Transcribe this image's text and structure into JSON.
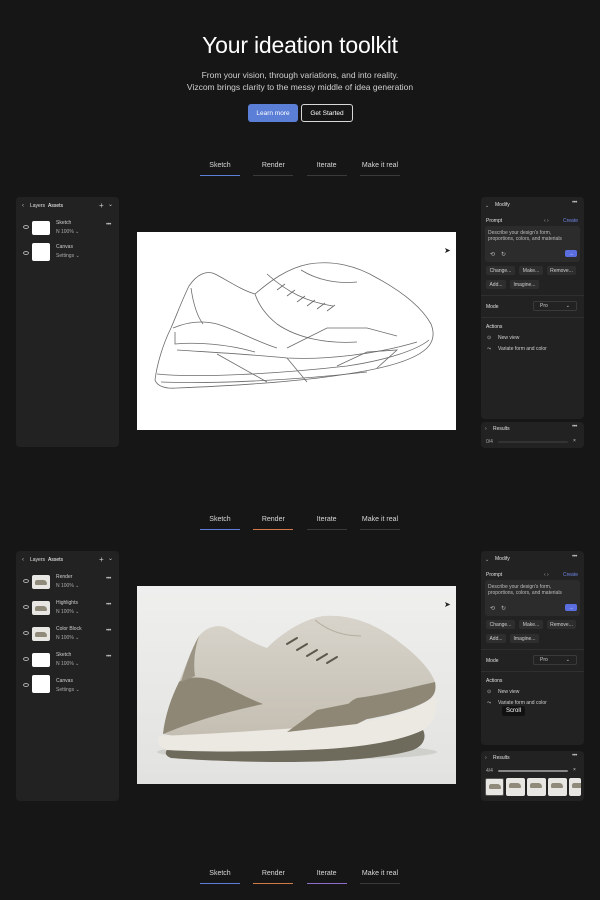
{
  "hero": {
    "title": "Your ideation toolkit",
    "subtitle_line1": "From your vision, through variations, and into reality.",
    "subtitle_line2": "Vizcom brings clarity to the messy middle of idea generation",
    "learn_more": "Learn more",
    "get_started": "Get Started"
  },
  "tabs": [
    "Sketch",
    "Render",
    "Iterate",
    "Make it real"
  ],
  "layers_panel": {
    "tab_layers": "Layers",
    "tab_assets": "Assets",
    "add": "+",
    "chevron": "⌄",
    "more": "•••"
  },
  "section1": {
    "layers": [
      {
        "name": "Sketch",
        "meta": "N 100%"
      },
      {
        "name": "Canvas",
        "meta": "Settings"
      }
    ],
    "results_count": "0/4"
  },
  "section2": {
    "layers": [
      {
        "name": "Render",
        "meta": "N 100%"
      },
      {
        "name": "Highlights",
        "meta": "N 100%"
      },
      {
        "name": "Color Block",
        "meta": "N 100%"
      },
      {
        "name": "Sketch",
        "meta": "N 100%"
      },
      {
        "name": "Canvas",
        "meta": "Settings"
      }
    ],
    "results_count": "4/4",
    "tooltip": "Scroll"
  },
  "modify_panel": {
    "title": "Modify",
    "prompt_label": "Prompt",
    "prompt_nav": "‹ ›",
    "create": "Create",
    "prompt_placeholder_line1": "Describe your design's form,",
    "prompt_placeholder_line2": "proportions, colors, and materials",
    "send": "→",
    "chips": [
      "Change...",
      "Make...",
      "Remove...",
      "Add...",
      "Imagine..."
    ],
    "mode_label": "Mode",
    "mode_value": "Pro",
    "actions_label": "Actions",
    "actions": [
      "New view",
      "Variate form and color"
    ]
  },
  "results_panel": {
    "title": "Results",
    "close": "×"
  },
  "colors": {
    "background": "#161616",
    "panel": "#222222",
    "accent_blue": "#5b7fd6",
    "tab_render": "#d07a4a",
    "tab_iterate": "#8a6ec8"
  }
}
